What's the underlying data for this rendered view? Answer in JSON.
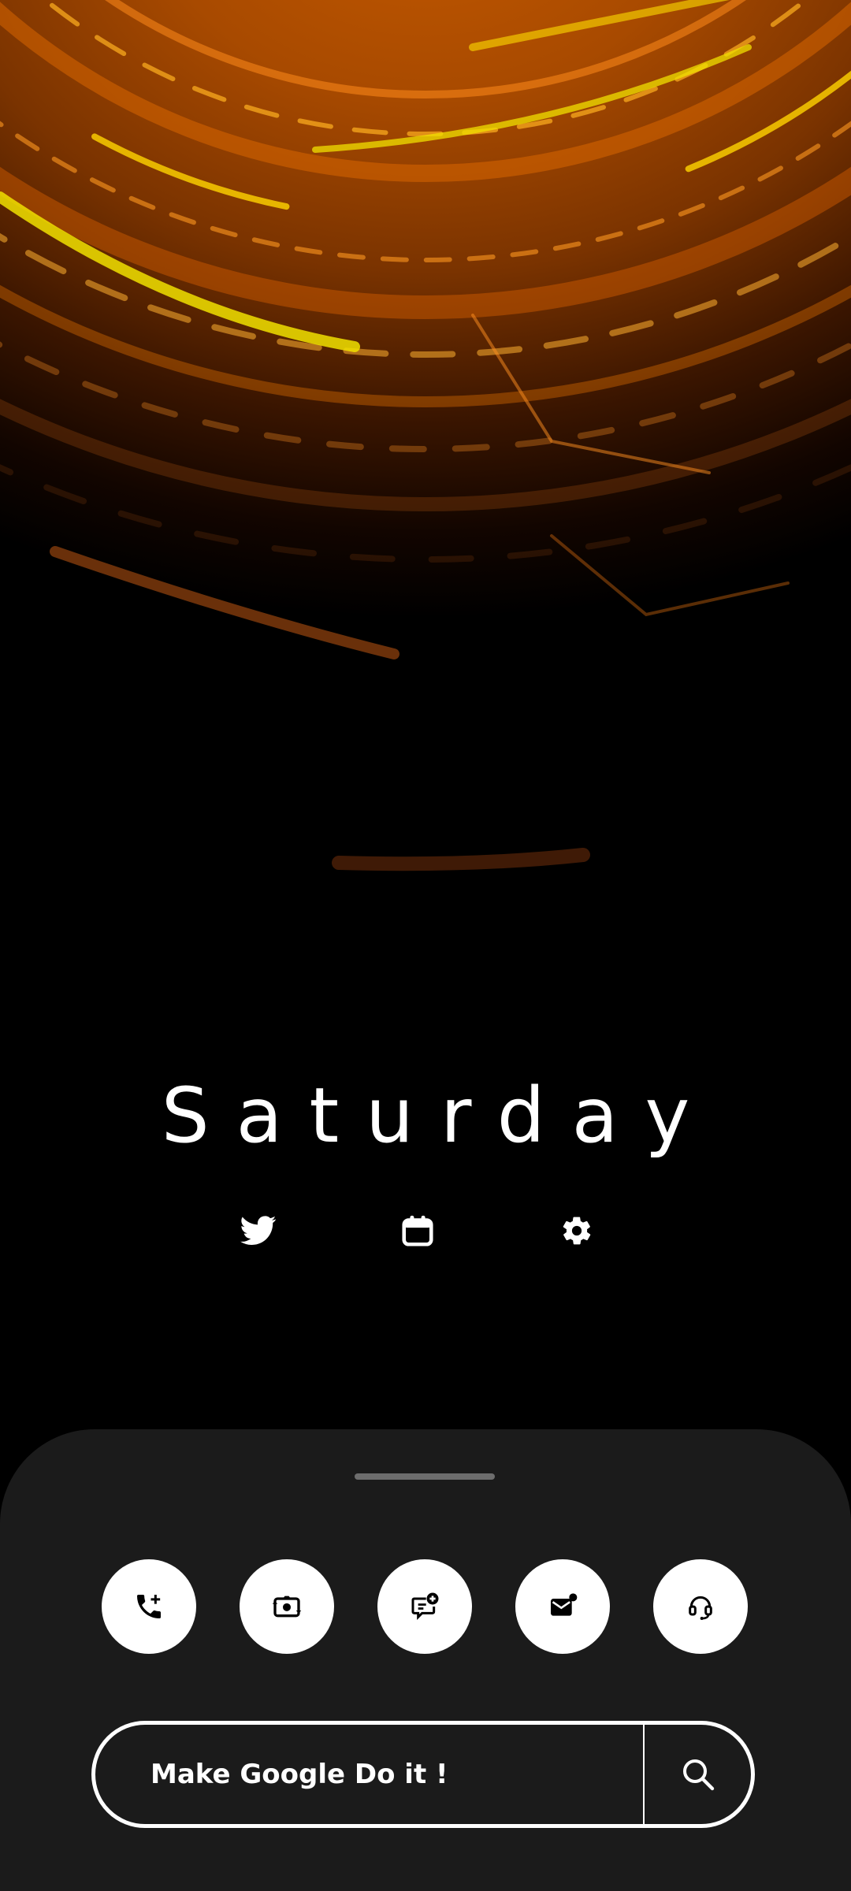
{
  "wallpaper": {
    "name": "orange-circuit-arcs"
  },
  "day": {
    "label": "Saturday"
  },
  "quick_icons": [
    {
      "icon": "twitter-icon"
    },
    {
      "icon": "calendar-icon"
    },
    {
      "icon": "gear-icon"
    }
  ],
  "actions": [
    {
      "icon": "phone-add-icon"
    },
    {
      "icon": "camera-switch-icon"
    },
    {
      "icon": "chat-add-icon"
    },
    {
      "icon": "mail-notification-icon"
    },
    {
      "icon": "headset-icon"
    }
  ],
  "search": {
    "placeholder": "Make Google Do it !",
    "icon": "search-icon"
  },
  "colors": {
    "accent": "#f07a00",
    "highlight": "#e8d000",
    "sheet": "#1b1b1b",
    "button": "#ffffff"
  }
}
